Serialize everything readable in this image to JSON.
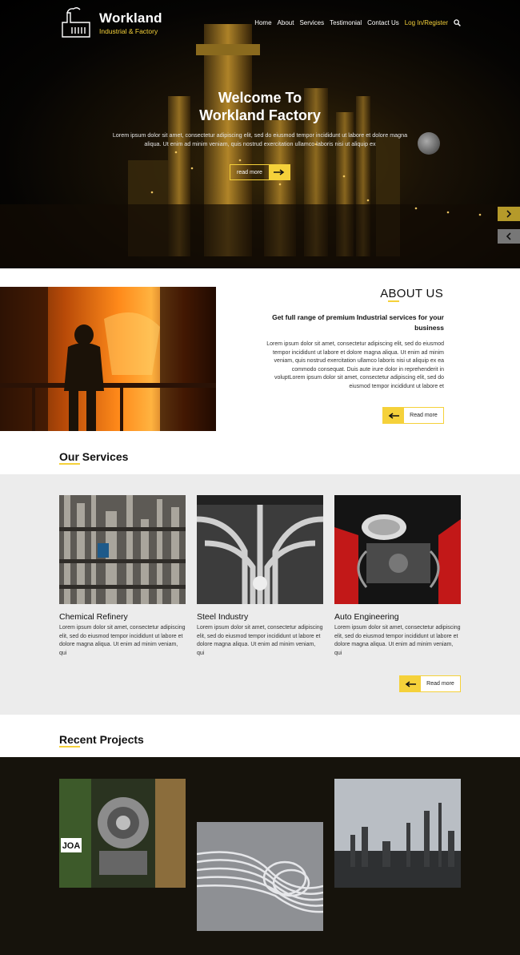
{
  "brand": {
    "name": "Workland",
    "tagline": "Industrial & Factory"
  },
  "nav": {
    "items": [
      "Home",
      "About",
      "Services",
      "Testimonial",
      "Contact Us"
    ],
    "login": "Log In/Register"
  },
  "hero": {
    "title_line1": "Welcome To",
    "title_line2": "Workland Factory",
    "text": "Lorem ipsum dolor sit amet, consectetur adipiscing elit, sed do eiusmod tempor incididunt ut labore et dolore magna aliqua. Ut enim ad minim veniam, quis nostrud exercitation ullamco laboris nisi ut aliquip ex",
    "button": "read more"
  },
  "about": {
    "title": "ABOUT US",
    "subtitle": "Get full range of premium Industrial services for your business",
    "text": "Lorem ipsum dolor sit amet, consectetur adipiscing elit, sed do eiusmod tempor incididunt ut labore et dolore magna aliqua. Ut enim ad minim veniam, quis nostrud exercitation ullamco laboris nisi ut aliquip ex ea commodo consequat. Duis aute irure dolor in reprehenderit in voluptLorem ipsum dolor sit amet, consectetur adipiscing elit, sed do eiusmod tempor incididunt ut labore et",
    "button": "Read more"
  },
  "services": {
    "title": "Our Services",
    "items": [
      {
        "name": "Chemical Refinery",
        "text": "Lorem ipsum dolor sit amet, consectetur adipiscing elit, sed do eiusmod tempor incididunt ut labore et dolore magna aliqua. Ut enim ad minim veniam, qui"
      },
      {
        "name": "Steel Industry",
        "text": "Lorem ipsum dolor sit amet, consectetur adipiscing elit, sed do eiusmod tempor incididunt ut labore et dolore magna aliqua. Ut enim ad minim veniam, qui"
      },
      {
        "name": "Auto Engineering",
        "text": "Lorem ipsum dolor sit amet, consectetur adipiscing elit, sed do eiusmod tempor incididunt ut labore et dolore magna aliqua. Ut enim ad minim veniam, qui"
      }
    ],
    "button": "Read more"
  },
  "projects": {
    "title": "Recent Projects",
    "plate_text": "JOA"
  },
  "colors": {
    "accent": "#f5d13a",
    "dark": "#16130c",
    "band": "#ececec"
  }
}
